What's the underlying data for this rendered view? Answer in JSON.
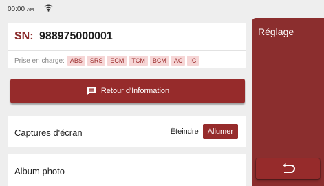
{
  "status": {
    "time": "00:00",
    "ampm": "AM"
  },
  "sn": {
    "label": "SN:",
    "value": "988975000001"
  },
  "support": {
    "label": "Prise en charge:",
    "systems": [
      "ABS",
      "SRS",
      "ECM",
      "TCM",
      "BCM",
      "AC",
      "IC"
    ]
  },
  "info_button": {
    "label": "Retour d'Information"
  },
  "screenshots": {
    "label": "Captures d'écran",
    "off_label": "Éteindre",
    "on_label": "Allumer",
    "selected": "Allumer"
  },
  "album": {
    "label": "Album photo"
  },
  "side": {
    "title": "Réglage"
  },
  "colors": {
    "accent": "#962b2b",
    "panel": "#8b2e2e",
    "badge_bg": "#f6d6d6",
    "background": "#eeeeee"
  },
  "icons": {
    "wifi": "wifi-icon",
    "info": "feedback-icon",
    "back": "back-icon"
  }
}
